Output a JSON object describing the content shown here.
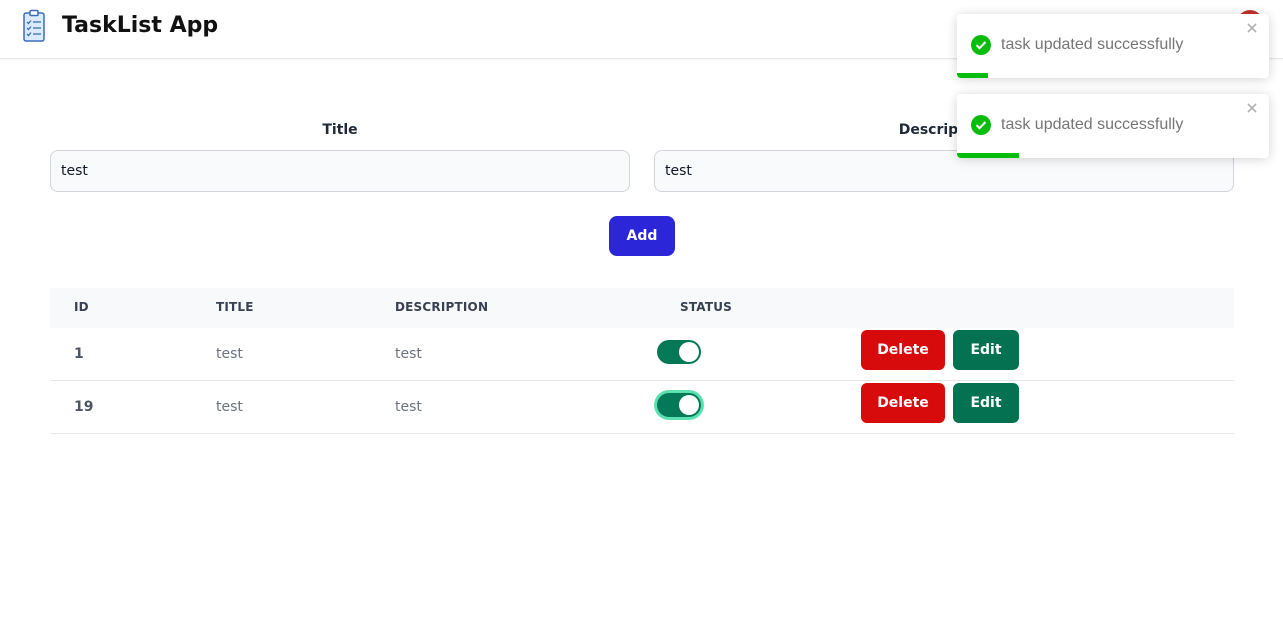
{
  "header": {
    "title": "TaskList App",
    "logo_icon": "clipboard-list-icon",
    "avatar_icon": "flag-avatar"
  },
  "form": {
    "title_label": "Title",
    "title_value": "test",
    "description_label": "Description",
    "description_value": "test",
    "add_label": "Add"
  },
  "table": {
    "columns": [
      "ID",
      "TITLE",
      "DESCRIPTION",
      "STATUS"
    ],
    "rows": [
      {
        "id": "1",
        "title": "test",
        "description": "test",
        "status": true,
        "delete_label": "Delete",
        "edit_label": "Edit"
      },
      {
        "id": "19",
        "title": "test",
        "description": "test",
        "status": true,
        "delete_label": "Delete",
        "edit_label": "Edit"
      }
    ]
  },
  "toasts": [
    {
      "message": "task updated successfully",
      "progress": 0.1
    },
    {
      "message": "task updated successfully",
      "progress": 0.2
    }
  ],
  "colors": {
    "primary": "#2b27d8",
    "delete": "#d70b0b",
    "edit": "#047150",
    "toggle_on": "#047857",
    "toast_success": "#07bc0c"
  }
}
